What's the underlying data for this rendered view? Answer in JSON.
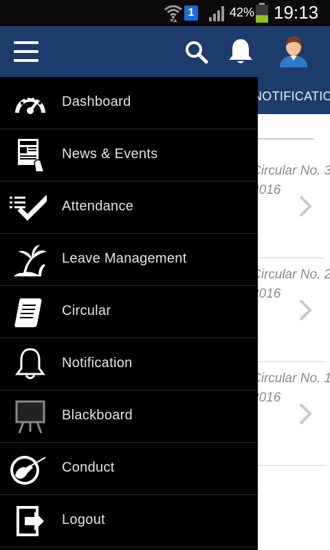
{
  "status_bar": {
    "wifi_icon": "wifi-icon",
    "sim_badge": "1",
    "signal_icon": "signal-icon",
    "battery_percent": "42%",
    "battery_level": 0.42,
    "time": "19:13"
  },
  "app_bar": {
    "menu_icon": "hamburger-menu-icon",
    "search_icon": "search-icon",
    "notification_icon": "bell-icon",
    "avatar_icon": "user-avatar-icon",
    "background_color": "#1e3c6b"
  },
  "background_page": {
    "tab_label": "NOTIFICATION",
    "items": [
      {
        "title": "Circular No. 3",
        "date": "2016",
        "chevron": "chevron-right-icon"
      },
      {
        "title": "Circular No. 2",
        "date": "2016",
        "chevron": "chevron-right-icon"
      },
      {
        "title": "Circular No. 1",
        "date": "2016",
        "chevron": "chevron-right-icon"
      }
    ]
  },
  "drawer": {
    "items": [
      {
        "label": "Dashboard",
        "icon": "speedometer-icon"
      },
      {
        "label": "News & Events",
        "icon": "newspaper-icon"
      },
      {
        "label": "Attendance",
        "icon": "checklist-icon"
      },
      {
        "label": "Leave Management",
        "icon": "palm-tree-icon"
      },
      {
        "label": "Circular",
        "icon": "scroll-icon"
      },
      {
        "label": "Notification",
        "icon": "bell-icon"
      },
      {
        "label": "Blackboard",
        "icon": "blackboard-icon"
      },
      {
        "label": "Conduct",
        "icon": "conductor-icon"
      },
      {
        "label": "Logout",
        "icon": "logout-icon"
      }
    ]
  }
}
